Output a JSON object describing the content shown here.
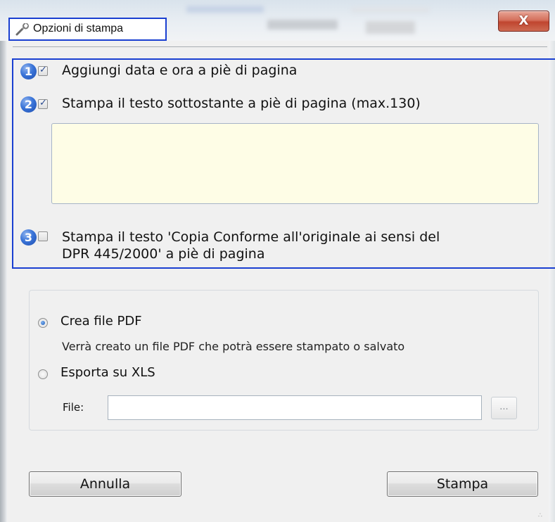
{
  "window": {
    "title": "Opzioni di stampa",
    "close_label": "X"
  },
  "options": {
    "badge1": "1",
    "badge2": "2",
    "badge3": "3",
    "add_datetime_label": "Aggiungi data e ora a piè di pagina",
    "add_datetime_checked": true,
    "print_text_label": "Stampa il testo sottostante a piè di pagina (max.130)",
    "print_text_checked": true,
    "footer_text_value": "",
    "copia_conforme_line1": "Stampa il testo 'Copia Conforme all'originale ai sensi del",
    "copia_conforme_line2": "DPR 445/2000' a piè di pagina",
    "copia_conforme_checked": false
  },
  "output": {
    "pdf_label": "Crea file PDF",
    "pdf_description": "Verrà creato un file PDF che potrà essere stampato o salvato",
    "pdf_selected": true,
    "xls_label": "Esporta su XLS",
    "xls_selected": false,
    "file_label": "File:",
    "file_value": "",
    "browse_label": "..."
  },
  "buttons": {
    "cancel_label": "Annulla",
    "print_label": "Stampa"
  },
  "colors": {
    "highlight": "#1a3fd1",
    "textarea_bg": "#fefde6",
    "badge": "#3a74d8"
  }
}
